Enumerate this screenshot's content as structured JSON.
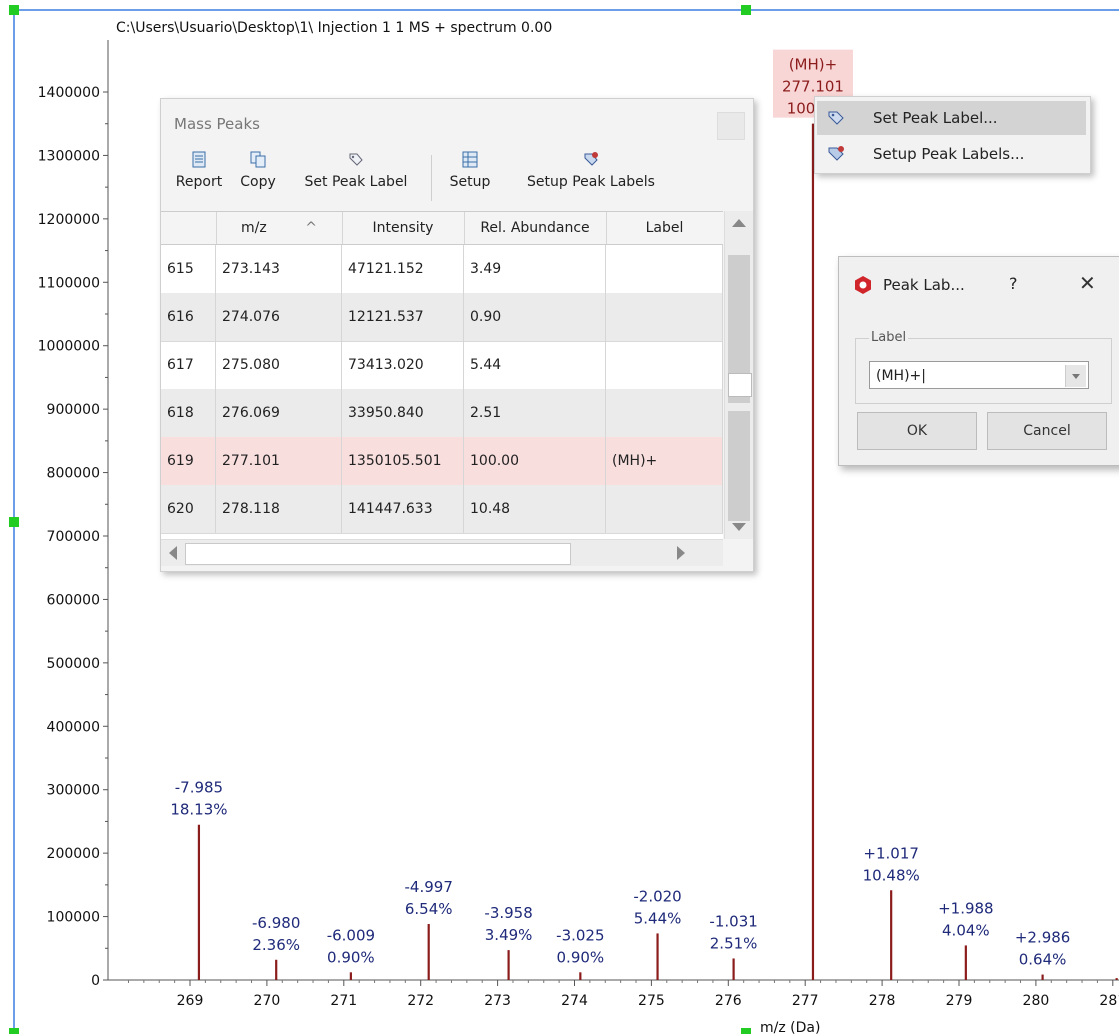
{
  "chart_data": {
    "type": "bar",
    "title": "C:\\Users\\Usuario\\Desktop\\1\\ Injection 1 1 MS + spectrum 0.00",
    "xlabel": "m/z (Da)",
    "ylabel": "",
    "xlim": [
      268.4,
      281.3
    ],
    "ylim": [
      0,
      1400000
    ],
    "xticks": [
      "269",
      "270",
      "271",
      "272",
      "273",
      "274",
      "275",
      "276",
      "277",
      "278",
      "279",
      "280",
      "281"
    ],
    "yticks": [
      "0",
      "100000",
      "200000",
      "300000",
      "400000",
      "500000",
      "600000",
      "700000",
      "800000",
      "900000",
      "1000000",
      "1100000",
      "1200000",
      "1300000",
      "1400000"
    ],
    "peaks": [
      {
        "mz": 269.116,
        "intensity": 244800,
        "labels": [
          "-7.985",
          "18.13%"
        ]
      },
      {
        "mz": 270.121,
        "intensity": 31900,
        "labels": [
          "-6.980",
          "2.36%"
        ]
      },
      {
        "mz": 271.092,
        "intensity": 12100,
        "labels": [
          "-6.009",
          "0.90%"
        ]
      },
      {
        "mz": 272.104,
        "intensity": 88300,
        "labels": [
          "-4.997",
          "6.54%"
        ]
      },
      {
        "mz": 273.143,
        "intensity": 47121,
        "labels": [
          "-3.958",
          "3.49%"
        ]
      },
      {
        "mz": 274.076,
        "intensity": 12122,
        "labels": [
          "-3.025",
          "0.90%"
        ]
      },
      {
        "mz": 275.08,
        "intensity": 73413,
        "labels": [
          "-2.020",
          "5.44%"
        ]
      },
      {
        "mz": 276.069,
        "intensity": 33951,
        "labels": [
          "-1.031",
          "2.51%"
        ]
      },
      {
        "mz": 277.101,
        "intensity": 1350106,
        "labels": [
          "(MH)+",
          "277.101",
          "100.00"
        ],
        "highlight": true
      },
      {
        "mz": 278.118,
        "intensity": 141448,
        "labels": [
          "+1.017",
          "10.48%"
        ]
      },
      {
        "mz": 279.089,
        "intensity": 54500,
        "labels": [
          "+1.988",
          "4.04%"
        ]
      },
      {
        "mz": 280.087,
        "intensity": 8600,
        "labels": [
          "+2.986",
          "0.64%"
        ]
      },
      {
        "mz": 281.05,
        "intensity": 3000,
        "labels": []
      }
    ]
  },
  "mass_peaks": {
    "title": "Mass Peaks",
    "toolbar": {
      "report": "Report",
      "copy": "Copy",
      "set_peak_label": "Set Peak Label",
      "setup": "Setup",
      "setup_peak_labels": "Setup Peak Labels"
    },
    "columns": {
      "mz": "m/z",
      "sort": "^",
      "intensity": "Intensity",
      "rel": "Rel. Abundance",
      "label": "Label"
    },
    "rows": [
      {
        "idx": "615",
        "mz": "273.143",
        "intensity": "47121.152",
        "rel": "3.49",
        "label": ""
      },
      {
        "idx": "616",
        "mz": "274.076",
        "intensity": "12121.537",
        "rel": "0.90",
        "label": ""
      },
      {
        "idx": "617",
        "mz": "275.080",
        "intensity": "73413.020",
        "rel": "5.44",
        "label": ""
      },
      {
        "idx": "618",
        "mz": "276.069",
        "intensity": "33950.840",
        "rel": "2.51",
        "label": ""
      },
      {
        "idx": "619",
        "mz": "277.101",
        "intensity": "1350105.501",
        "rel": "100.00",
        "label": "(MH)+"
      },
      {
        "idx": "620",
        "mz": "278.118",
        "intensity": "141447.633",
        "rel": "10.48",
        "label": ""
      }
    ]
  },
  "context_menu": {
    "set_peak_label": "Set Peak Label...",
    "setup_peak_labels": "Setup Peak Labels..."
  },
  "peak_dialog": {
    "title": "Peak Lab...",
    "help": "?",
    "close": "✕",
    "group_label": "Label",
    "value": "(MH)+|",
    "ok": "OK",
    "cancel": "Cancel"
  },
  "colors": {
    "peak": "#8b1c1c",
    "annotation": "#1f2a7a",
    "highlight": "#f9d6d6",
    "selection_frame": "#3b7de0",
    "handle": "#22cc22"
  }
}
